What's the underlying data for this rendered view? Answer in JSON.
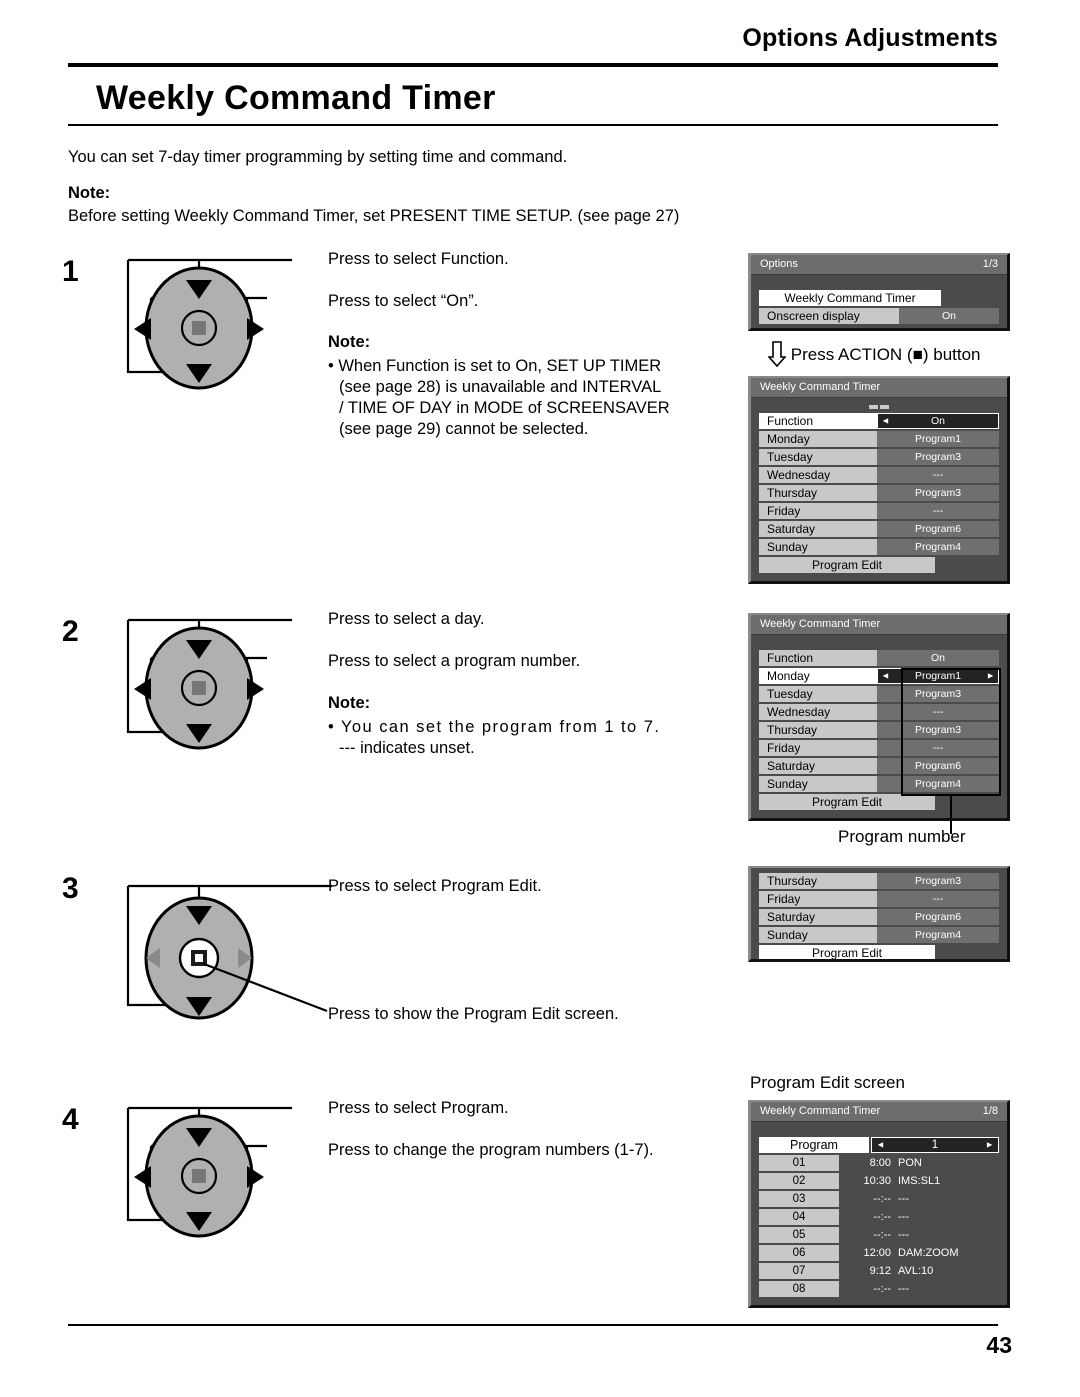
{
  "header": {
    "title": "Options Adjustments",
    "section_title": "Weekly Command Timer"
  },
  "intro": {
    "description": "You can set 7-day timer programming by setting time and command.",
    "note_label": "Note:",
    "note_text": "Before setting Weekly Command Timer, set PRESENT TIME SETUP.  (see page 27)"
  },
  "steps": [
    {
      "number": "1",
      "callout_up": "Press to select Function.",
      "callout_side": "Press to select “On”.",
      "note_label": "Note:",
      "note_lines": [
        "• When Function is set to On, SET UP TIMER",
        "(see page 28) is unavailable and INTERVAL",
        "/ TIME OF DAY in MODE of SCREENSAVER",
        "(see page 29) cannot be selected."
      ]
    },
    {
      "number": "2",
      "callout_up": "Press to select a day.",
      "callout_side": "Press to select a program number.",
      "note_label": "Note:",
      "note_lines": [
        "• You can set the program from 1 to 7.",
        "--- indicates unset."
      ]
    },
    {
      "number": "3",
      "callout_up": "Press to select Program Edit.",
      "callout_center": "Press to show the Program Edit screen."
    },
    {
      "number": "4",
      "callout_up": "Press to select Program.",
      "callout_side": "Press to change the program numbers (1-7)."
    }
  ],
  "annotations": {
    "press_action": "Press ACTION (■) button",
    "program_number": "Program number",
    "program_edit_screen": "Program Edit screen"
  },
  "osd_options": {
    "title": "Options",
    "page": "1/3",
    "rows": [
      {
        "label": "Weekly Command Timer",
        "value": ""
      },
      {
        "label": "Onscreen display",
        "value": "On"
      }
    ]
  },
  "osd_wct_1": {
    "title": "Weekly Command Timer",
    "rows": [
      {
        "label": "Function",
        "value": "On"
      },
      {
        "label": "Monday",
        "value": "Program1"
      },
      {
        "label": "Tuesday",
        "value": "Program3"
      },
      {
        "label": "Wednesday",
        "value": "---"
      },
      {
        "label": "Thursday",
        "value": "Program3"
      },
      {
        "label": "Friday",
        "value": "---"
      },
      {
        "label": "Saturday",
        "value": "Program6"
      },
      {
        "label": "Sunday",
        "value": "Program4"
      }
    ],
    "footer_button": "Program Edit"
  },
  "osd_wct_2": {
    "title": "Weekly Command Timer",
    "rows": [
      {
        "label": "Function",
        "value": "On"
      },
      {
        "label": "Monday",
        "value": "Program1"
      },
      {
        "label": "Tuesday",
        "value": "Program3"
      },
      {
        "label": "Wednesday",
        "value": "---"
      },
      {
        "label": "Thursday",
        "value": "Program3"
      },
      {
        "label": "Friday",
        "value": "---"
      },
      {
        "label": "Saturday",
        "value": "Program6"
      },
      {
        "label": "Sunday",
        "value": "Program4"
      }
    ],
    "footer_button": "Program Edit"
  },
  "osd_wct_3": {
    "rows": [
      {
        "label": "Thursday",
        "value": "Program3"
      },
      {
        "label": "Friday",
        "value": "---"
      },
      {
        "label": "Saturday",
        "value": "Program6"
      },
      {
        "label": "Sunday",
        "value": "Program4"
      }
    ],
    "footer_button": "Program Edit"
  },
  "osd_program_edit": {
    "title": "Weekly Command Timer",
    "page": "1/8",
    "program_label": "Program",
    "program_value": "1",
    "entries": [
      {
        "no": "01",
        "time": "8:00",
        "command": "PON"
      },
      {
        "no": "02",
        "time": "10:30",
        "command": "IMS:SL1"
      },
      {
        "no": "03",
        "time": "--:--",
        "command": "---"
      },
      {
        "no": "04",
        "time": "--:--",
        "command": "---"
      },
      {
        "no": "05",
        "time": "--:--",
        "command": "---"
      },
      {
        "no": "06",
        "time": "12:00",
        "command": "DAM:ZOOM"
      },
      {
        "no": "07",
        "time": "9:12",
        "command": "AVL:10"
      },
      {
        "no": "08",
        "time": "--:--",
        "command": "---"
      }
    ]
  },
  "footer": {
    "page_number": "43"
  }
}
